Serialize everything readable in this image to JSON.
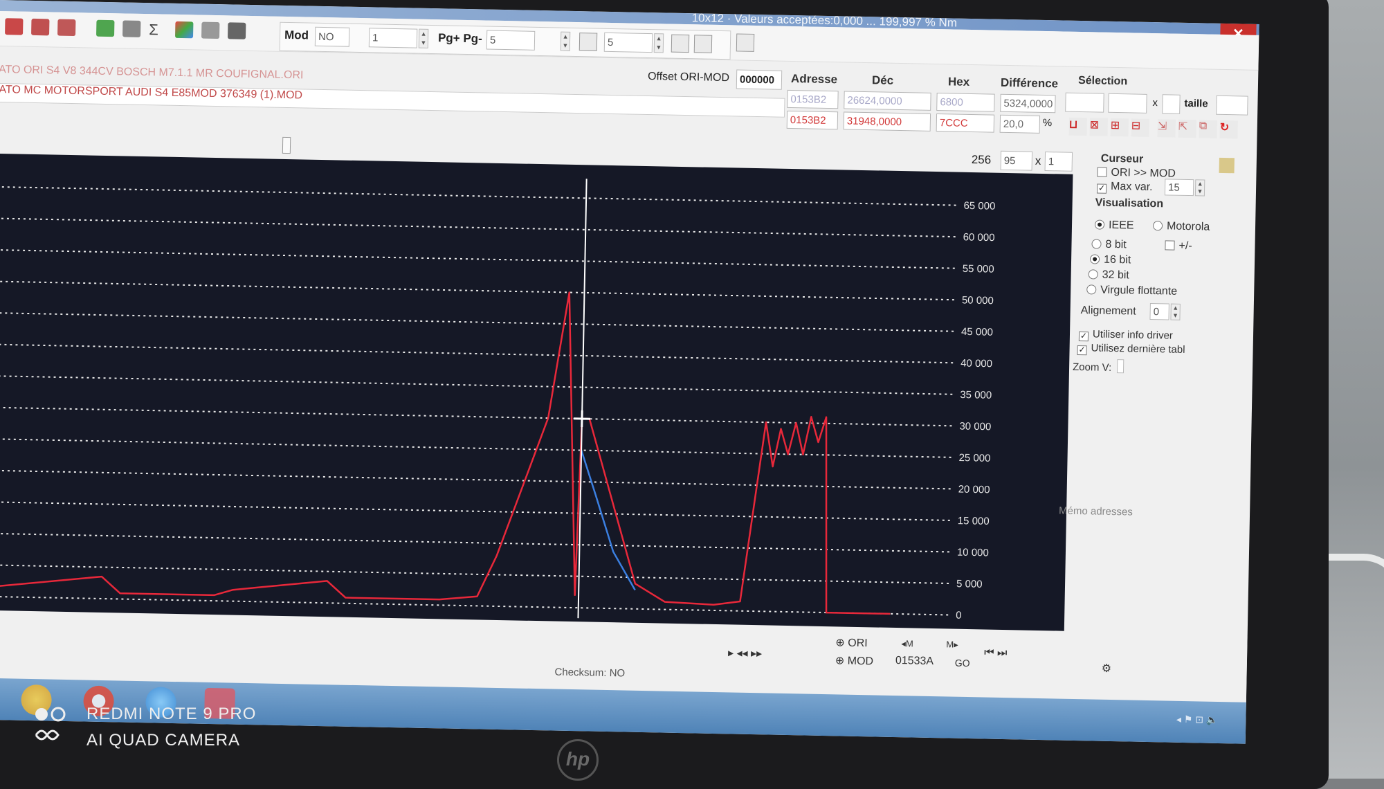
{
  "window": {
    "title_fragment": "10x12 · Valeurs acceptées:0,000 ... 199,997 % Nm"
  },
  "toolbar": {
    "mod_label": "Mod",
    "mod_value": "NO",
    "step_value": "1",
    "pg_label": "Pg+ Pg-",
    "pg_value": "5",
    "cols_value": "5"
  },
  "files": {
    "ori": "ATO ORI S4 V8 344CV BOSCH M7.1.1 MR COUFIGNAL.ORI",
    "mod": "ATO MC MOTORSPORT AUDI S4 E85MOD 376349 (1).MOD"
  },
  "offset": {
    "label": "Offset ORI-MOD",
    "value": "000000"
  },
  "table": {
    "headers": {
      "adresse": "Adresse",
      "dec": "Déc",
      "hex": "Hex",
      "difference": "Différence",
      "selection": "Sélection"
    },
    "ori": {
      "adresse": "0153B2",
      "dec": "26624,0000",
      "hex": "6800",
      "difference": "5324,0000"
    },
    "mod": {
      "adresse": "0153B2",
      "dec": "31948,0000",
      "hex": "7CCC",
      "difference": "20,0",
      "pct": "%"
    }
  },
  "selection": {
    "x_label": "x",
    "size_label": "taille"
  },
  "chart_controls": {
    "width": "256",
    "height": "95",
    "x": "x",
    "mult": "1"
  },
  "right_panel": {
    "cursor_title": "Curseur",
    "ori_mod": "ORI >> MOD",
    "max_var": "Max var.",
    "max_var_value": "15",
    "visualisation": "Visualisation",
    "ieee": "IEEE",
    "motorola": "Motorola",
    "bit8": "8 bit",
    "plusminus": "+/-",
    "bit16": "16 bit",
    "bit32": "32 bit",
    "float": "Virgule flottante",
    "alignement": "Alignement",
    "alignement_value": "0",
    "use_driver": "Utiliser info driver",
    "use_last": "Utilisez dernière tabl",
    "zoom_v": "Zoom V:",
    "memo": "Mémo adresses"
  },
  "bottom": {
    "ori": "ORI",
    "mod": "MOD",
    "address": "01533A",
    "go": "GO",
    "checksum": "Checksum: NO"
  },
  "watermark": {
    "line1": "REDMI NOTE 9 PRO",
    "line2": "AI QUAD CAMERA"
  },
  "chart_data": {
    "type": "line",
    "y_ticks": [
      "65 000",
      "60 000",
      "55 000",
      "50 000",
      "45 000",
      "40 000",
      "35 000",
      "30 000",
      "25 000",
      "20 000",
      "15 000",
      "10 000",
      "5 000",
      "0"
    ],
    "ylim": [
      0,
      65000
    ],
    "xlim": [
      0,
      256
    ],
    "grid": true,
    "series": [
      {
        "color": "#e8283a",
        "points": [
          [
            0,
            1500
          ],
          [
            30,
            3500
          ],
          [
            35,
            900
          ],
          [
            60,
            900
          ],
          [
            65,
            1800
          ],
          [
            90,
            3500
          ],
          [
            95,
            900
          ],
          [
            120,
            900
          ],
          [
            130,
            1500
          ],
          [
            135,
            8000
          ],
          [
            148,
            30000
          ],
          [
            153,
            50000
          ],
          [
            156,
            2000
          ],
          [
            157,
            30000
          ],
          [
            159,
            30000
          ],
          [
            164,
            20000
          ],
          [
            172,
            4000
          ],
          [
            180,
            1200
          ],
          [
            193,
            900
          ],
          [
            200,
            1500
          ],
          [
            206,
            30000
          ],
          [
            208,
            23000
          ],
          [
            210,
            29000
          ],
          [
            212,
            25000
          ],
          [
            214,
            30000
          ],
          [
            216,
            25000
          ],
          [
            218,
            31000
          ],
          [
            220,
            27000
          ],
          [
            222,
            31000
          ],
          [
            223,
            0
          ],
          [
            240,
            0
          ]
        ]
      },
      {
        "color": "#3b7fe0",
        "points": [
          [
            157,
            25000
          ],
          [
            161,
            18000
          ],
          [
            166,
            9000
          ],
          [
            172,
            3000
          ]
        ]
      }
    ],
    "cursor_x": 157
  }
}
